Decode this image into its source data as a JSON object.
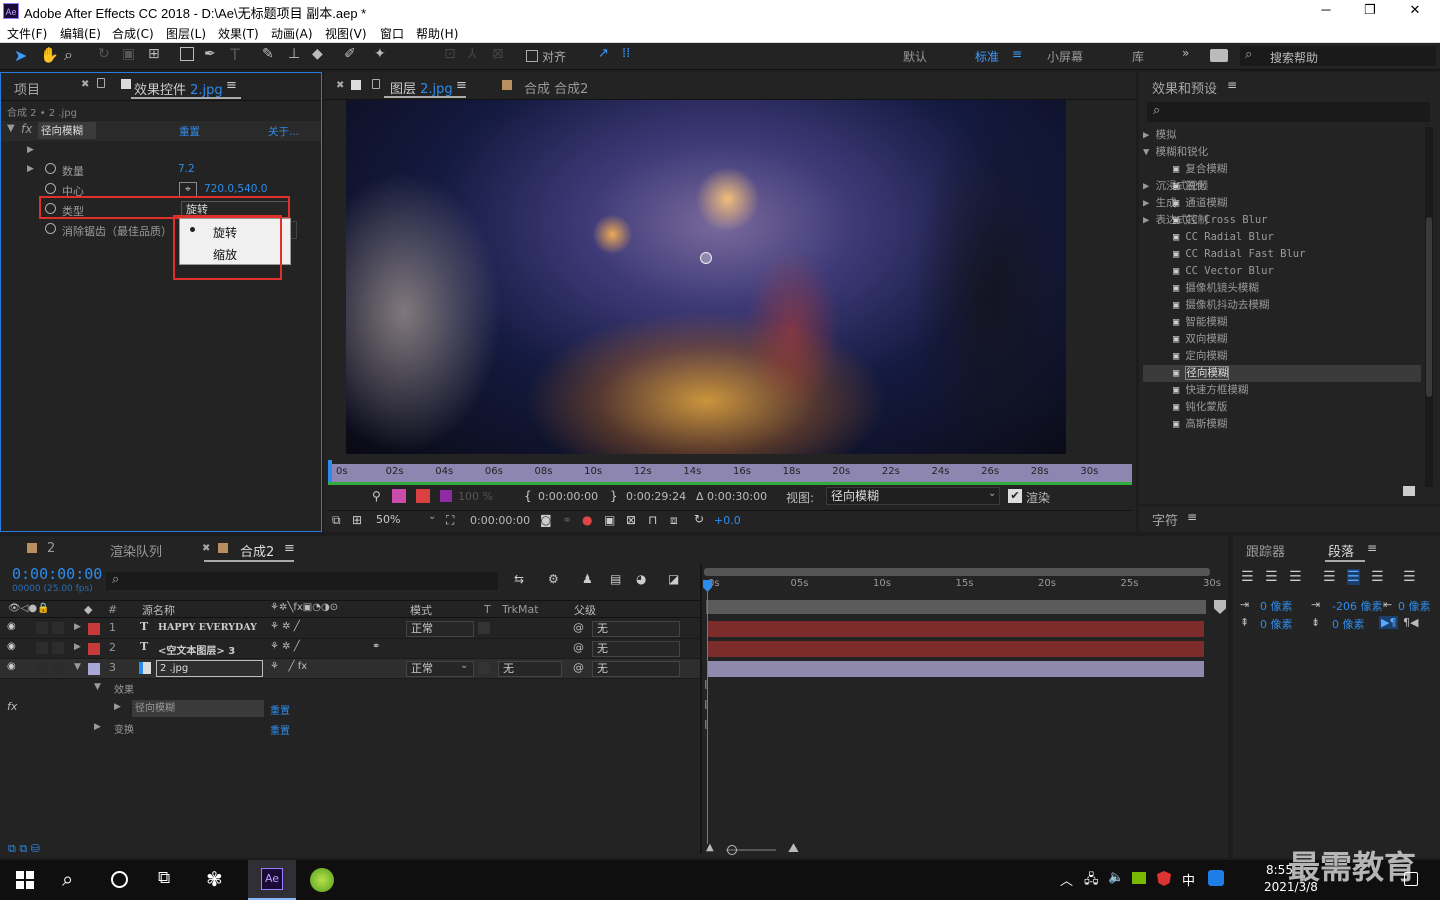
{
  "window": {
    "title": "Adobe After Effects CC 2018 - D:\\Ae\\无标题项目 副本.aep *",
    "app_icon": "Ae",
    "minimize": "─",
    "restore": "❐",
    "close": "✕"
  },
  "menu": [
    "文件(F)",
    "编辑(E)",
    "合成(C)",
    "图层(L)",
    "效果(T)",
    "动画(A)",
    "视图(V)",
    "窗口",
    "帮助(H)"
  ],
  "toolbar": {
    "snap_label": "对齐",
    "workspaces": [
      "默认",
      "标准",
      "小屏幕",
      "库"
    ],
    "active_workspace": "标准",
    "search_help_placeholder": "搜索帮助"
  },
  "effects_controls": {
    "tab_project": "项目",
    "tab_label": "效果控件",
    "tab_file": "2.jpg",
    "breadcrumb": "合成 2 • 2 .jpg",
    "effect_name": "径向模糊",
    "reset": "重置",
    "about": "关于...",
    "props": [
      {
        "label": "数量",
        "value": "7.2"
      },
      {
        "label": "中心",
        "value": "720.0,540.0"
      },
      {
        "label": "类型",
        "value": "旋转"
      },
      {
        "label": "消除锯齿（最佳品质）",
        "value": ""
      }
    ],
    "dropdown_options": [
      "旋转",
      "缩放"
    ],
    "dropdown_selected": "旋转"
  },
  "viewer": {
    "tab_layer_prefix": "图层",
    "tab_layer_file": "2.jpg",
    "tab_comp": "合成 合成2",
    "ruler_ticks": [
      "0s",
      "02s",
      "04s",
      "06s",
      "08s",
      "10s",
      "12s",
      "14s",
      "16s",
      "18s",
      "20s",
      "22s",
      "24s",
      "26s",
      "28s",
      "30s"
    ],
    "opacity": "100 %",
    "in_time": "0:00:00:00",
    "out_time": "0:00:29:24",
    "duration": "Δ 0:00:30:00",
    "view_label": "视图:",
    "view_value": "径向模糊",
    "render_label": "渲染",
    "zoom": "50%",
    "current_time": "0:00:00:00",
    "exposure": "+0.0"
  },
  "effects_presets": {
    "title": "效果和预设",
    "search_placeholder": "",
    "categories_top": [
      "模拟",
      "模糊和锐化"
    ],
    "items": [
      "复合模糊",
      "锐化",
      "通道模糊",
      "CC Cross Blur",
      "CC Radial Blur",
      "CC Radial Fast Blur",
      "CC Vector Blur",
      "摄像机镜头模糊",
      "摄像机抖动去模糊",
      "智能模糊",
      "双向模糊",
      "定向模糊",
      "径向模糊",
      "快速方框模糊",
      "钝化蒙版",
      "高斯模糊"
    ],
    "selected_item": "径向模糊",
    "categories_bottom": [
      "沉浸式视频",
      "生成",
      "表达式控制"
    ],
    "character_tab": "字符"
  },
  "timeline": {
    "tabs": [
      "2",
      "渲染队列",
      "合成2"
    ],
    "timecode": "0:00:00:00",
    "fps": "00000 (25.00 fps)",
    "columns": {
      "num": "#",
      "name": "源名称",
      "mode": "模式",
      "t": "T",
      "trkmat": "TrkMat",
      "parent": "父级"
    },
    "layers": [
      {
        "num": "1",
        "type": "T",
        "name": "HAPPY EVERYDAY",
        "mode": "正常",
        "trkmat": "",
        "parent": "无",
        "color": "#c63a3a"
      },
      {
        "num": "2",
        "type": "T",
        "name": "<空文本图层> 3",
        "mode": "",
        "trkmat": "",
        "parent": "无",
        "color": "#c63a3a"
      },
      {
        "num": "3",
        "type": "img",
        "name": "2 .jpg",
        "mode": "正常",
        "trkmat": "无",
        "parent": "无",
        "color": "#a8a8d8"
      }
    ],
    "sub_effects": "效果",
    "sub_effect_name": "径向模糊",
    "sub_reset": "重置",
    "sub_transform": "变换",
    "ruler": [
      "0s",
      "05s",
      "10s",
      "15s",
      "20s",
      "25s",
      "30s"
    ]
  },
  "paragraph": {
    "tab_tracker": "跟踪器",
    "tab_paragraph": "段落",
    "indent_left": "0 像素",
    "indent_first": "-206 像素",
    "indent_right": "0 像素",
    "space_before": "0 像素",
    "space_after": "0 像素"
  },
  "taskbar": {
    "time": "8:55",
    "date": "2021/3/8",
    "ime": "中",
    "watermark": "最需教育"
  },
  "colors": {
    "accent_blue": "#2d8ceb",
    "highlight_red": "#e0302a",
    "layer_red": "#7d2c2c",
    "layer_purple": "#8f8aad"
  }
}
